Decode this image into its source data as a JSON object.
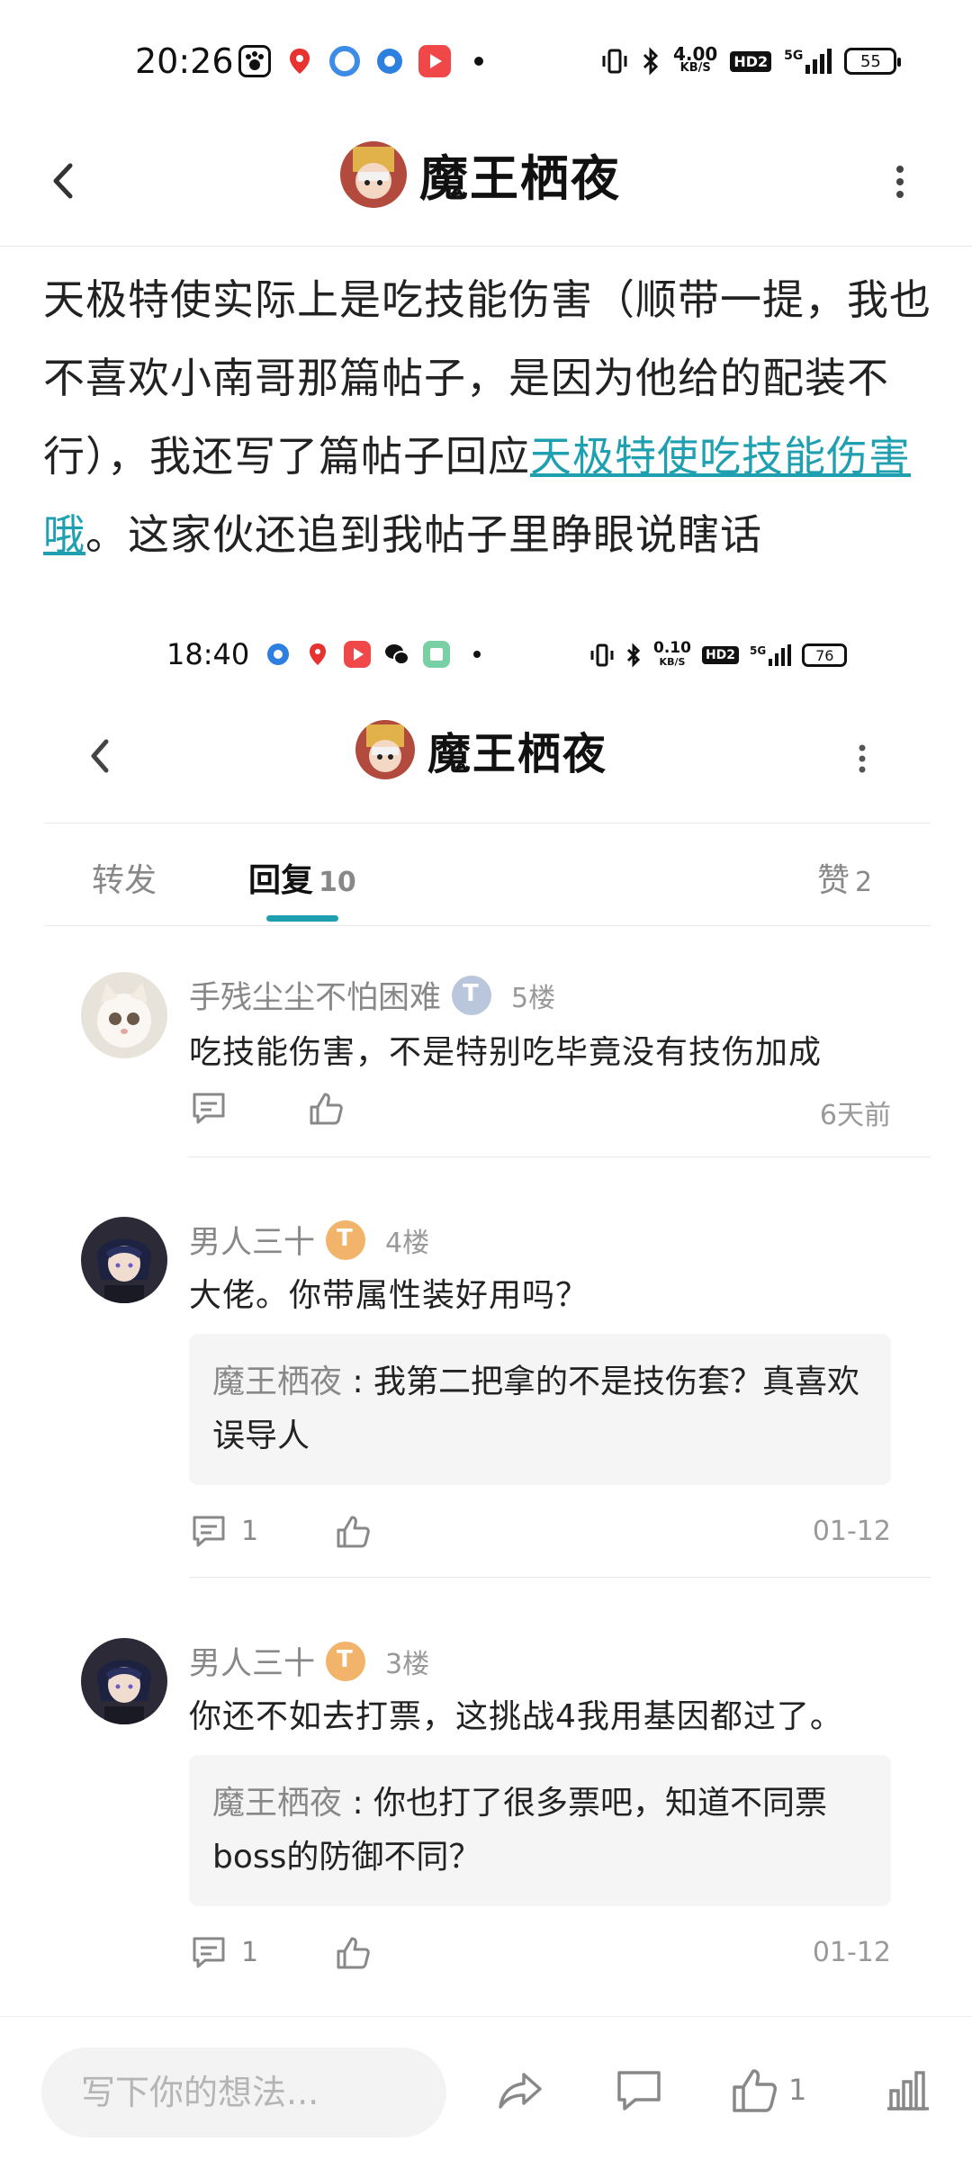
{
  "status_bar": {
    "time": "20:26",
    "speed_value": "4.00",
    "speed_unit": "KB/S",
    "hd": "HD2",
    "signal": "5G",
    "battery": "55"
  },
  "header": {
    "title": "魔王栖夜"
  },
  "main_text": {
    "part1": "天极特使实际上是吃技能伤害（顺带一提，我也不喜欢小南哥那篇帖子，是因为他给的配装不行），我还写了篇帖子回应",
    "link": "天极特使吃技能伤害哦",
    "part2": "。这家伙还追到我帖子里睁眼说瞎话"
  },
  "inner": {
    "status_bar": {
      "time": "18:40",
      "speed_value": "0.10",
      "speed_unit": "KB/S",
      "hd": "HD2",
      "signal": "5G",
      "battery": "76"
    },
    "header": {
      "title": "魔王栖夜"
    },
    "tabs": [
      {
        "label": "转发",
        "count": ""
      },
      {
        "label": "回复",
        "count": "10"
      },
      {
        "label": "赞",
        "count": "2"
      }
    ],
    "replies": [
      {
        "name": "手残尘尘不怕困难",
        "floor": "5楼",
        "text": "吃技能伤害，不是特别吃毕竟没有技伤加成",
        "time": "6天前",
        "comment_count": "",
        "badge_color": "#b9c6dc"
      },
      {
        "name": "男人三十",
        "floor": "4楼",
        "text": "大佬。你带属性装好用吗？",
        "quote_name": "魔王栖夜",
        "quote_text": "我第二把拿的不是技伤套？真喜欢误导人",
        "time": "01-12",
        "comment_count": "1",
        "badge_color": "#f2b46b"
      },
      {
        "name": "男人三十",
        "floor": "3楼",
        "text": "你还不如去打票，这挑战4我用基因都过了。",
        "quote_name": "魔王栖夜",
        "quote_text": "你也打了很多票吧，知道不同票boss的防御不同？",
        "time": "01-12",
        "comment_count": "1",
        "badge_color": "#f2b46b"
      }
    ]
  },
  "bottom_bar": {
    "placeholder": "写下你的想法...",
    "like_count": "1"
  },
  "colors": {
    "accent": "#1fa0b1",
    "muted": "#888888"
  }
}
